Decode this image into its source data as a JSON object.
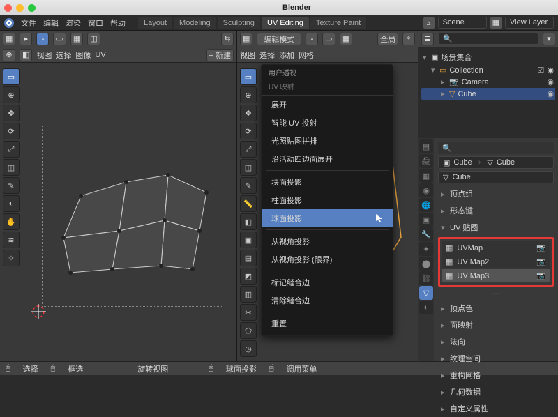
{
  "app": {
    "title": "Blender"
  },
  "top_menu": [
    "文件",
    "编辑",
    "渲染",
    "窗口",
    "帮助"
  ],
  "workspaces": {
    "tabs": [
      "Layout",
      "Modeling",
      "Sculpting",
      "UV Editing",
      "Texture Paint"
    ],
    "active": "UV Editing"
  },
  "scene_bar": {
    "scene_label": "Scene",
    "view_layer_label": "View Layer"
  },
  "uv_pane": {
    "header_items": [
      "视图",
      "选择",
      "图像",
      "UV"
    ],
    "header_extra": "+ 新建",
    "new_button_icon": "✚",
    "status": [
      "选择",
      "框选",
      "旋转视图"
    ]
  },
  "viewport": {
    "mode_label": "编辑模式",
    "menu_items": [
      "视图",
      "选择",
      "添加",
      "网格"
    ],
    "overlay_label": "全局",
    "context_menu": {
      "title": "用户透视",
      "sub": "UV 映射",
      "groups": [
        [
          "展开",
          "智能 UV 投射",
          "光照贴图拼排",
          "沿活动四边面展开"
        ],
        [
          "块面投影",
          "柱面投影",
          "球面投影"
        ],
        [
          "从视角投影",
          "从视角投影 (限界)"
        ],
        [
          "标记缝合边",
          "清除缝合边"
        ],
        [
          "重置"
        ]
      ],
      "highlight": "球面投影"
    },
    "status": [
      "球面投影",
      "调用菜单"
    ]
  },
  "outliner": {
    "search_placeholder": "",
    "root": "场景集合",
    "collection": "Collection",
    "items": [
      {
        "name": "Camera",
        "icon": "camera"
      },
      {
        "name": "Cube",
        "icon": "mesh",
        "selected": true
      }
    ]
  },
  "properties": {
    "search_placeholder": "",
    "object_field": {
      "icon": "cube",
      "name": "Cube",
      "data": "Cube"
    },
    "mesh_field": {
      "icon": "mesh",
      "name": "Cube"
    },
    "panels_collapsed": [
      "顶点组",
      "形态键"
    ],
    "uv_panel": {
      "label": "UV 贴图",
      "maps": [
        {
          "name": "UVMap",
          "active_render": true
        },
        {
          "name": "UV Map2",
          "active_render": false
        },
        {
          "name": "UV Map3",
          "active_render": false,
          "selected": true
        }
      ]
    },
    "panels_after": [
      "顶点色",
      "面映射",
      "法向",
      "纹理空间",
      "重构网格",
      "几何数据",
      "自定义属性"
    ]
  },
  "icons": {
    "move": "✥",
    "rotate": "⟳",
    "scale": "⤢",
    "box": "▭",
    "lasso": "◠",
    "knife": "✂",
    "cube": "◧",
    "pan": "✋",
    "mesh": "▦",
    "camera": "📷",
    "eye": "◉",
    "shield": "◈"
  }
}
